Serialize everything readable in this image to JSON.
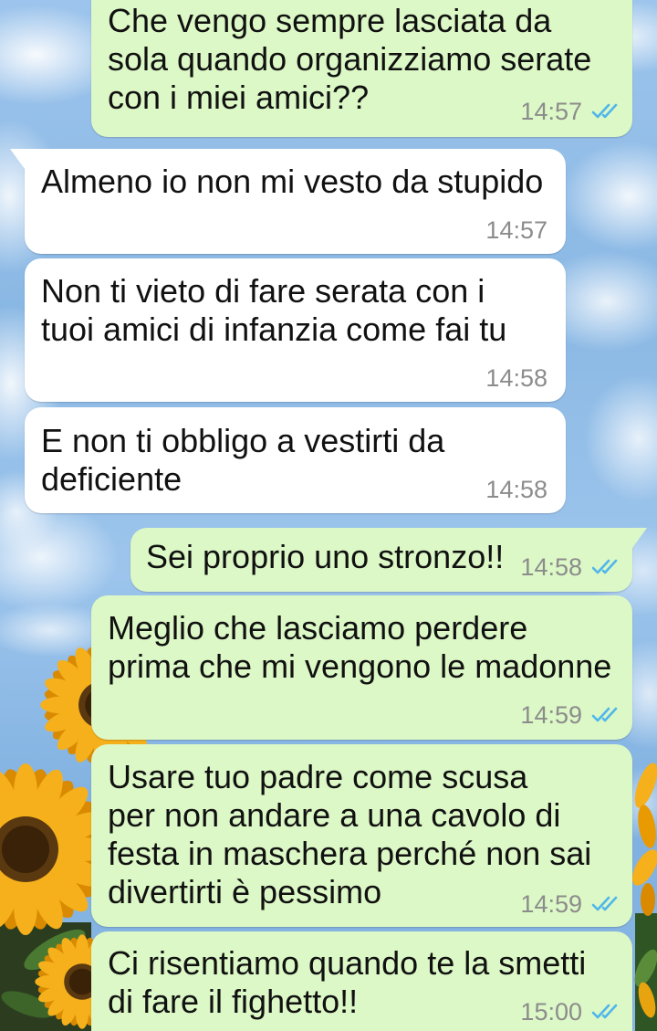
{
  "colors": {
    "outgoing_bubble": "#dcf8c6",
    "incoming_bubble": "#ffffff",
    "message_text": "#111111",
    "timestamp": "#8c8c8c",
    "read_checkmark": "#4fb6ec"
  },
  "chat": {
    "messages": [
      {
        "outgoing": true,
        "text": "Che vengo sempre lasciata da\nsola quando organizziamo serate\ncon i miei amici??",
        "time": "14:57",
        "status_icon": "double-check-icon"
      },
      {
        "outgoing": false,
        "text": "Almeno io non mi vesto da stupido",
        "time": "14:57"
      },
      {
        "outgoing": false,
        "text": "Non ti vieto di fare serata con i\ntuoi amici di infanzia come fai tu",
        "time": "14:58"
      },
      {
        "outgoing": false,
        "text": "E non ti obbligo a vestirti da\ndeficiente",
        "time": "14:58"
      },
      {
        "outgoing": true,
        "text": "Sei proprio uno stronzo!!",
        "time": "14:58",
        "status_icon": "double-check-icon"
      },
      {
        "outgoing": true,
        "text": "Meglio che lasciamo perdere\nprima che mi vengono le madonne",
        "time": "14:59",
        "status_icon": "double-check-icon"
      },
      {
        "outgoing": true,
        "text": "Usare tuo padre come scusa\nper non andare a una cavolo di\nfesta in maschera perché non sai\ndivertirti è pessimo",
        "time": "14:59",
        "status_icon": "double-check-icon"
      },
      {
        "outgoing": true,
        "text": "Ci risentiamo quando te la smetti\ndi fare il fighetto!!",
        "time": "15:00",
        "status_icon": "double-check-icon"
      }
    ]
  }
}
